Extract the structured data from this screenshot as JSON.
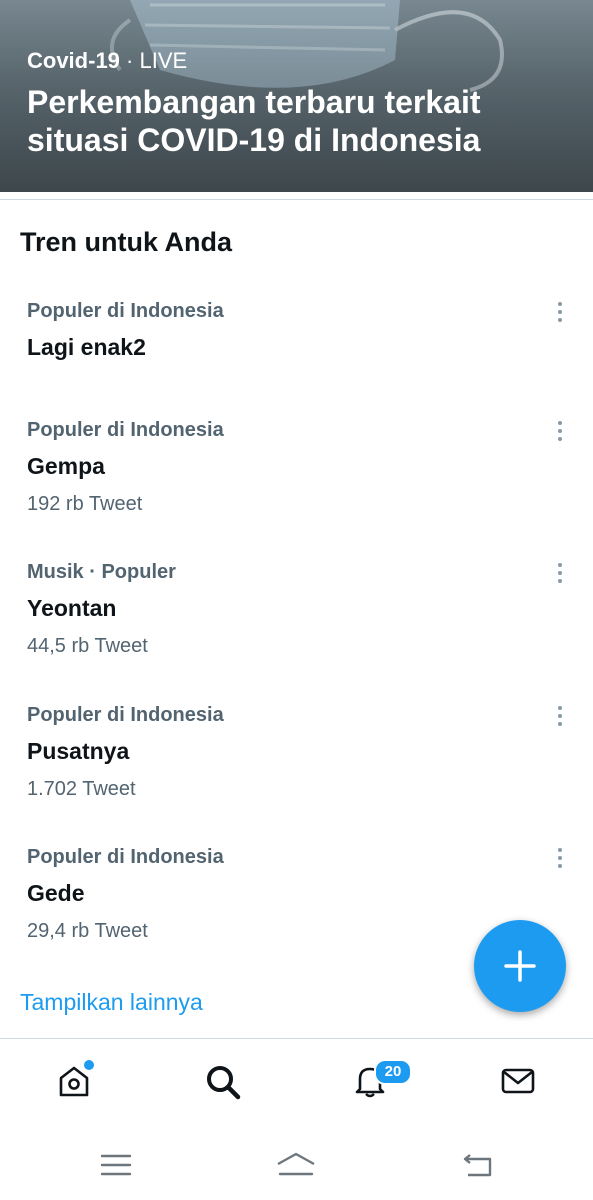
{
  "hero": {
    "category": "Covid-19",
    "separator": "·",
    "status": "LIVE",
    "title": "Perkembangan terbaru terkait situasi COVID-19 di Indonesia"
  },
  "section": {
    "title": "Tren untuk Anda"
  },
  "trends": [
    {
      "context": "Populer di Indonesia",
      "name": "Lagi enak2",
      "count": ""
    },
    {
      "context": "Populer di Indonesia",
      "name": "Gempa",
      "count": "192 rb Tweet"
    },
    {
      "context": "Musik · Populer",
      "name": "Yeontan",
      "count": "44,5 rb Tweet"
    },
    {
      "context": "Populer di Indonesia",
      "name": "Pusatnya",
      "count": "1.702 Tweet"
    },
    {
      "context": "Populer di Indonesia",
      "name": "Gede",
      "count": "29,4 rb Tweet"
    }
  ],
  "show_more": "Tampilkan lainnya",
  "fab": {
    "icon": "plus-icon"
  },
  "tabbar": {
    "home": {
      "icon": "home-icon",
      "has_dot": true
    },
    "search": {
      "icon": "search-icon",
      "active": true
    },
    "notifications": {
      "icon": "bell-icon",
      "badge": "20"
    },
    "messages": {
      "icon": "mail-icon"
    }
  },
  "system_nav": [
    "menu-icon",
    "home-nav-icon",
    "back-icon"
  ],
  "colors": {
    "accent": "#1d9bf0",
    "text": "#0f1419",
    "secondary": "#536471"
  }
}
